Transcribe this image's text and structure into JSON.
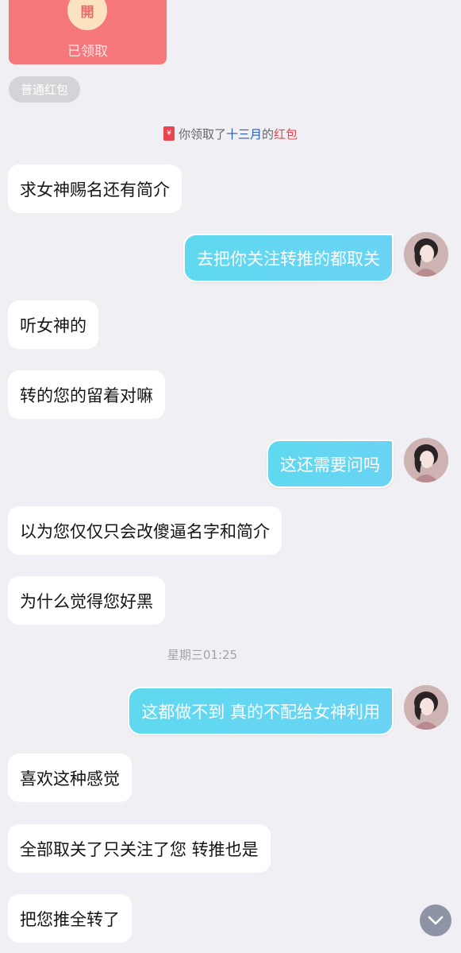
{
  "red_packet": {
    "seal_char": "開",
    "status": "已领取",
    "type_label": "普通红包"
  },
  "system_notice": {
    "prefix": "你领取了",
    "sender": "十三月",
    "middle": "的",
    "suffix": "红包"
  },
  "timestamp": "星期三01:25",
  "messages": [
    {
      "dir": "in",
      "text": "求女神赐名还有简介"
    },
    {
      "dir": "out",
      "text": "去把你关注转推的都取关"
    },
    {
      "dir": "in",
      "text": "听女神的"
    },
    {
      "dir": "in",
      "text": "转的您的留着对嘛"
    },
    {
      "dir": "out",
      "text": "这还需要问吗"
    },
    {
      "dir": "in",
      "text": "以为您仅仅只会改傻逼名字和简介"
    },
    {
      "dir": "in",
      "text": "为什么觉得您好黑"
    },
    {
      "dir": "out",
      "text": "这都做不到 真的不配给女神利用"
    },
    {
      "dir": "in",
      "text": "喜欢这种感觉"
    },
    {
      "dir": "in",
      "text": "全部取关了只关注了您 转推也是"
    },
    {
      "dir": "in",
      "text": "把您推全转了"
    }
  ],
  "icons": {
    "red_packet_small": "red-packet-icon",
    "avatar": "user-avatar",
    "scroll": "chevron-down-icon"
  },
  "colors": {
    "background": "#f0f0f4",
    "incoming_bubble": "#ffffff",
    "outgoing_bubble": "#62d6f1",
    "red_packet": "#f6777a",
    "highlight_blue": "#2a5bb4",
    "highlight_red": "#e8464e"
  }
}
